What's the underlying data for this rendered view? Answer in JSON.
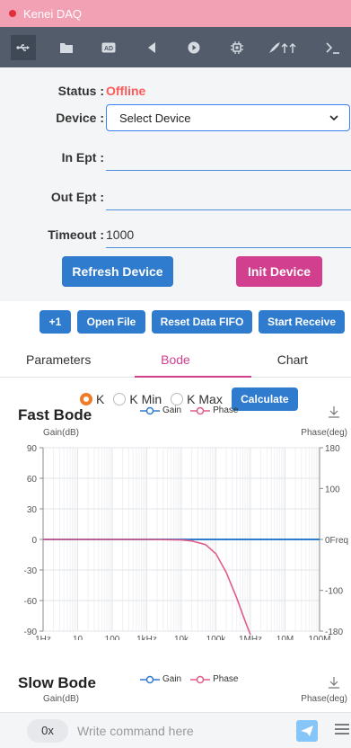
{
  "titlebar": {
    "title": "Kenei DAQ"
  },
  "toolbar": {
    "icons": [
      "usb-icon",
      "folder-icon",
      "ad-icon",
      "back-icon",
      "play-icon",
      "chip-icon",
      "rocket-icon",
      "terminal-icon"
    ]
  },
  "status": {
    "label": "Status :",
    "value": "Offline",
    "device_label": "Device :",
    "device_value": "Select Device",
    "in_ept_label": "In Ept :",
    "in_ept_value": "",
    "out_ept_label": "Out Ept :",
    "out_ept_value": "",
    "timeout_label": "Timeout :",
    "timeout_value": "1000",
    "refresh_label": "Refresh Device",
    "init_label": "Init Device"
  },
  "actions": {
    "plus1": "+1",
    "open_file": "Open File",
    "reset_fifo": "Reset Data FIFO",
    "start_receive": "Start Receive"
  },
  "tabs": [
    "Parameters",
    "Bode",
    "Chart"
  ],
  "bode": {
    "radio_options": [
      "K",
      "K Min",
      "K Max"
    ],
    "selected": "K",
    "calculate_label": "Calculate",
    "fast_title": "Fast Bode",
    "slow_title": "Slow Bode",
    "legend_gain": "Gain",
    "legend_phase": "Phase"
  },
  "chart_data": [
    {
      "type": "line",
      "title": "Fast Bode",
      "xlabel": "",
      "ylabel": "Gain(dB)",
      "y2label": "Phase(deg)",
      "x_ticks": [
        "1Hz",
        "10",
        "100",
        "1kHz",
        "10k",
        "100k",
        "1MHz",
        "10M",
        "100M"
      ],
      "y_ticks": [
        "90",
        "60",
        "30",
        "0",
        "-30",
        "-60",
        "-90"
      ],
      "y2_ticks": [
        "180",
        "100",
        "0Freq",
        "-100",
        "-180"
      ],
      "ylim": [
        -90,
        90
      ],
      "y2lim": [
        -180,
        180
      ],
      "x_log": true,
      "grid": true,
      "series": [
        {
          "name": "Gain",
          "color": "#2f7bcd",
          "x": [
            1,
            10,
            100,
            1000,
            10000,
            100000,
            1000000,
            10000000,
            100000000
          ],
          "y": [
            0,
            0,
            0,
            0,
            0,
            0,
            0,
            0,
            0
          ]
        },
        {
          "name": "Phase",
          "color": "#e05c8a",
          "x": [
            1,
            10,
            100,
            1000,
            10000,
            20000,
            50000,
            100000,
            200000,
            400000,
            700000,
            1000000
          ],
          "y": [
            0,
            0,
            0,
            0,
            -1,
            -3,
            -10,
            -28,
            -65,
            -115,
            -160,
            -190
          ]
        }
      ]
    },
    {
      "type": "line",
      "title": "Slow Bode",
      "ylabel": "Gain(dB)",
      "y2label": "Phase(deg)",
      "series": [
        {
          "name": "Gain"
        },
        {
          "name": "Phase"
        }
      ]
    }
  ],
  "bottom": {
    "prefix": "0x",
    "placeholder": "Write command here"
  },
  "colors": {
    "primary": "#2f7bcd",
    "accent": "#d23f8f",
    "toolbar": "#525c6b",
    "titlebar": "#f2a0b3",
    "offline": "#ff5a5a"
  }
}
